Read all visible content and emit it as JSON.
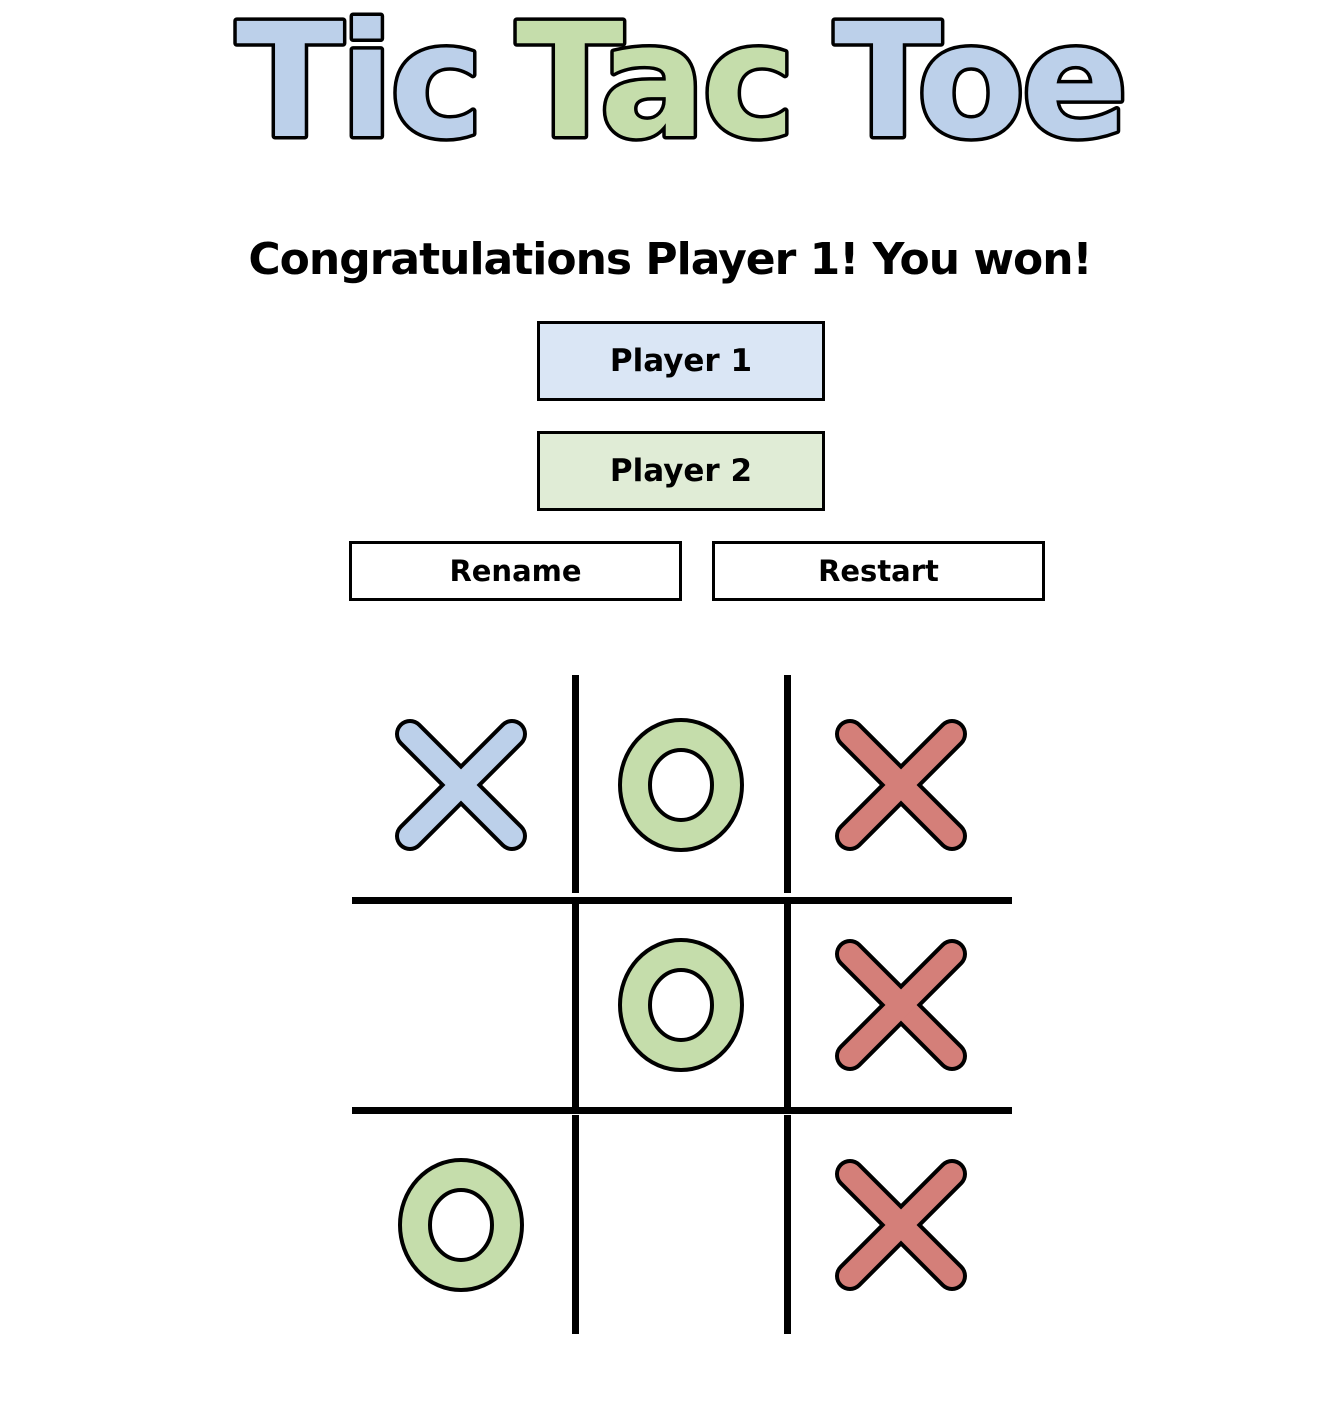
{
  "title": {
    "words": [
      {
        "text": "Tic",
        "color": "#bcd0ea"
      },
      {
        "text": "Tac",
        "color": "#c5ddab"
      },
      {
        "text": "Toe",
        "color": "#bcd0ea"
      }
    ]
  },
  "status_message": "Congratulations Player 1! You won!",
  "players": [
    {
      "label": "Player 1",
      "color": "#dae6f5"
    },
    {
      "label": "Player 2",
      "color": "#e0ecd6"
    }
  ],
  "buttons": {
    "rename_label": "Rename",
    "restart_label": "Restart"
  },
  "marks": {
    "x_player_color": "#bcd0ea",
    "x_win_color": "#d47f79",
    "o_color": "#c5ddab"
  },
  "board": [
    {
      "mark": "X",
      "winning": false
    },
    {
      "mark": "O",
      "winning": false
    },
    {
      "mark": "X",
      "winning": true
    },
    {
      "mark": "",
      "winning": false
    },
    {
      "mark": "O",
      "winning": false
    },
    {
      "mark": "X",
      "winning": true
    },
    {
      "mark": "O",
      "winning": false
    },
    {
      "mark": "",
      "winning": false
    },
    {
      "mark": "X",
      "winning": true
    }
  ]
}
